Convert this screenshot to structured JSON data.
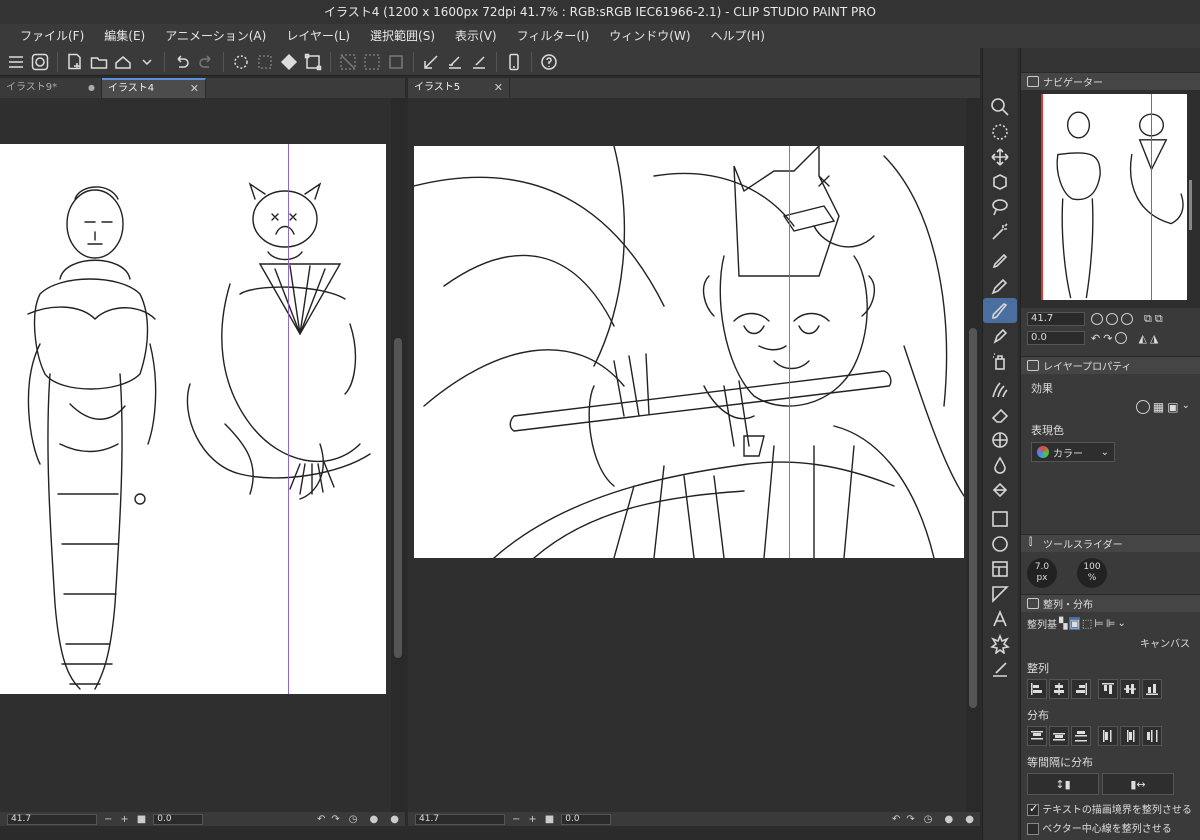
{
  "title": "イラスト4 (1200 x 1600px 72dpi 41.7% : RGB:sRGB IEC61966-2.1) - CLIP STUDIO PAINT PRO",
  "menu": [
    "ファイル(F)",
    "編集(E)",
    "アニメーション(A)",
    "レイヤー(L)",
    "選択範囲(S)",
    "表示(V)",
    "フィルター(I)",
    "ウィンドウ(W)",
    "ヘルプ(H)"
  ],
  "toolbar_icons": [
    "menu-icon",
    "app-logo-icon",
    "new-file-icon",
    "open-file-icon",
    "save-icon",
    "undo-icon",
    "redo-icon",
    "clear-icon",
    "fill-icon",
    "transform-icon",
    "deselect-icon",
    "select-area-icon",
    "snap-ruler-icon",
    "snap-grid-icon",
    "snap-special-icon",
    "phone-icon",
    "help-icon"
  ],
  "tabs_left": [
    {
      "label": "イラスト9*",
      "active": false,
      "modified": true
    },
    {
      "label": "イラスト4",
      "active": true
    }
  ],
  "tabs_right": [
    {
      "label": "イラスト5",
      "active": true
    }
  ],
  "status_left": {
    "zoom": "41.7",
    "angle": "0.0"
  },
  "status_right": {
    "zoom": "41.7",
    "angle": "0.0"
  },
  "tools": [
    "zoom-icon",
    "lasso-rotate-icon",
    "move-icon",
    "object-icon",
    "lasso-icon",
    "magic-wand-icon",
    "pen-icon",
    "pencil-icon",
    "brush-icon",
    "fill-brush-icon",
    "spray-icon",
    "blend-icon",
    "eraser-icon",
    "grid-icon",
    "water-icon",
    "bucket-icon",
    "gradient-icon",
    "ellipse-icon",
    "frame-icon",
    "ruler-icon",
    "text-icon",
    "burst-icon",
    "correct-line-icon"
  ],
  "active_tool": "brush-icon",
  "navigator": {
    "title": "ナビゲーター",
    "zoom": "41.7",
    "angle": "0.0"
  },
  "layer_props": {
    "title": "レイヤープロパティ",
    "effect_label": "効果",
    "color_label": "表現色",
    "color_value": "カラー"
  },
  "tool_slider": {
    "title": "ツールスライダー",
    "size_value": "7.0",
    "size_unit": "px",
    "opacity_value": "100",
    "opacity_unit": "%"
  },
  "align": {
    "title": "整列・分布",
    "basis_label": "整列基",
    "canvas_label": "キャンバス",
    "align_label": "整列",
    "distribute_label": "分布",
    "equal_label": "等間隔に分布",
    "check1": "テキストの描画境界を整列させる",
    "check1_on": true,
    "check2": "ベクター中心線を整列させる",
    "check2_on": false
  },
  "colors": {
    "accent": "#5c8fd6",
    "guide": "#8a56c9",
    "active_tool": "#4a6ea0"
  }
}
